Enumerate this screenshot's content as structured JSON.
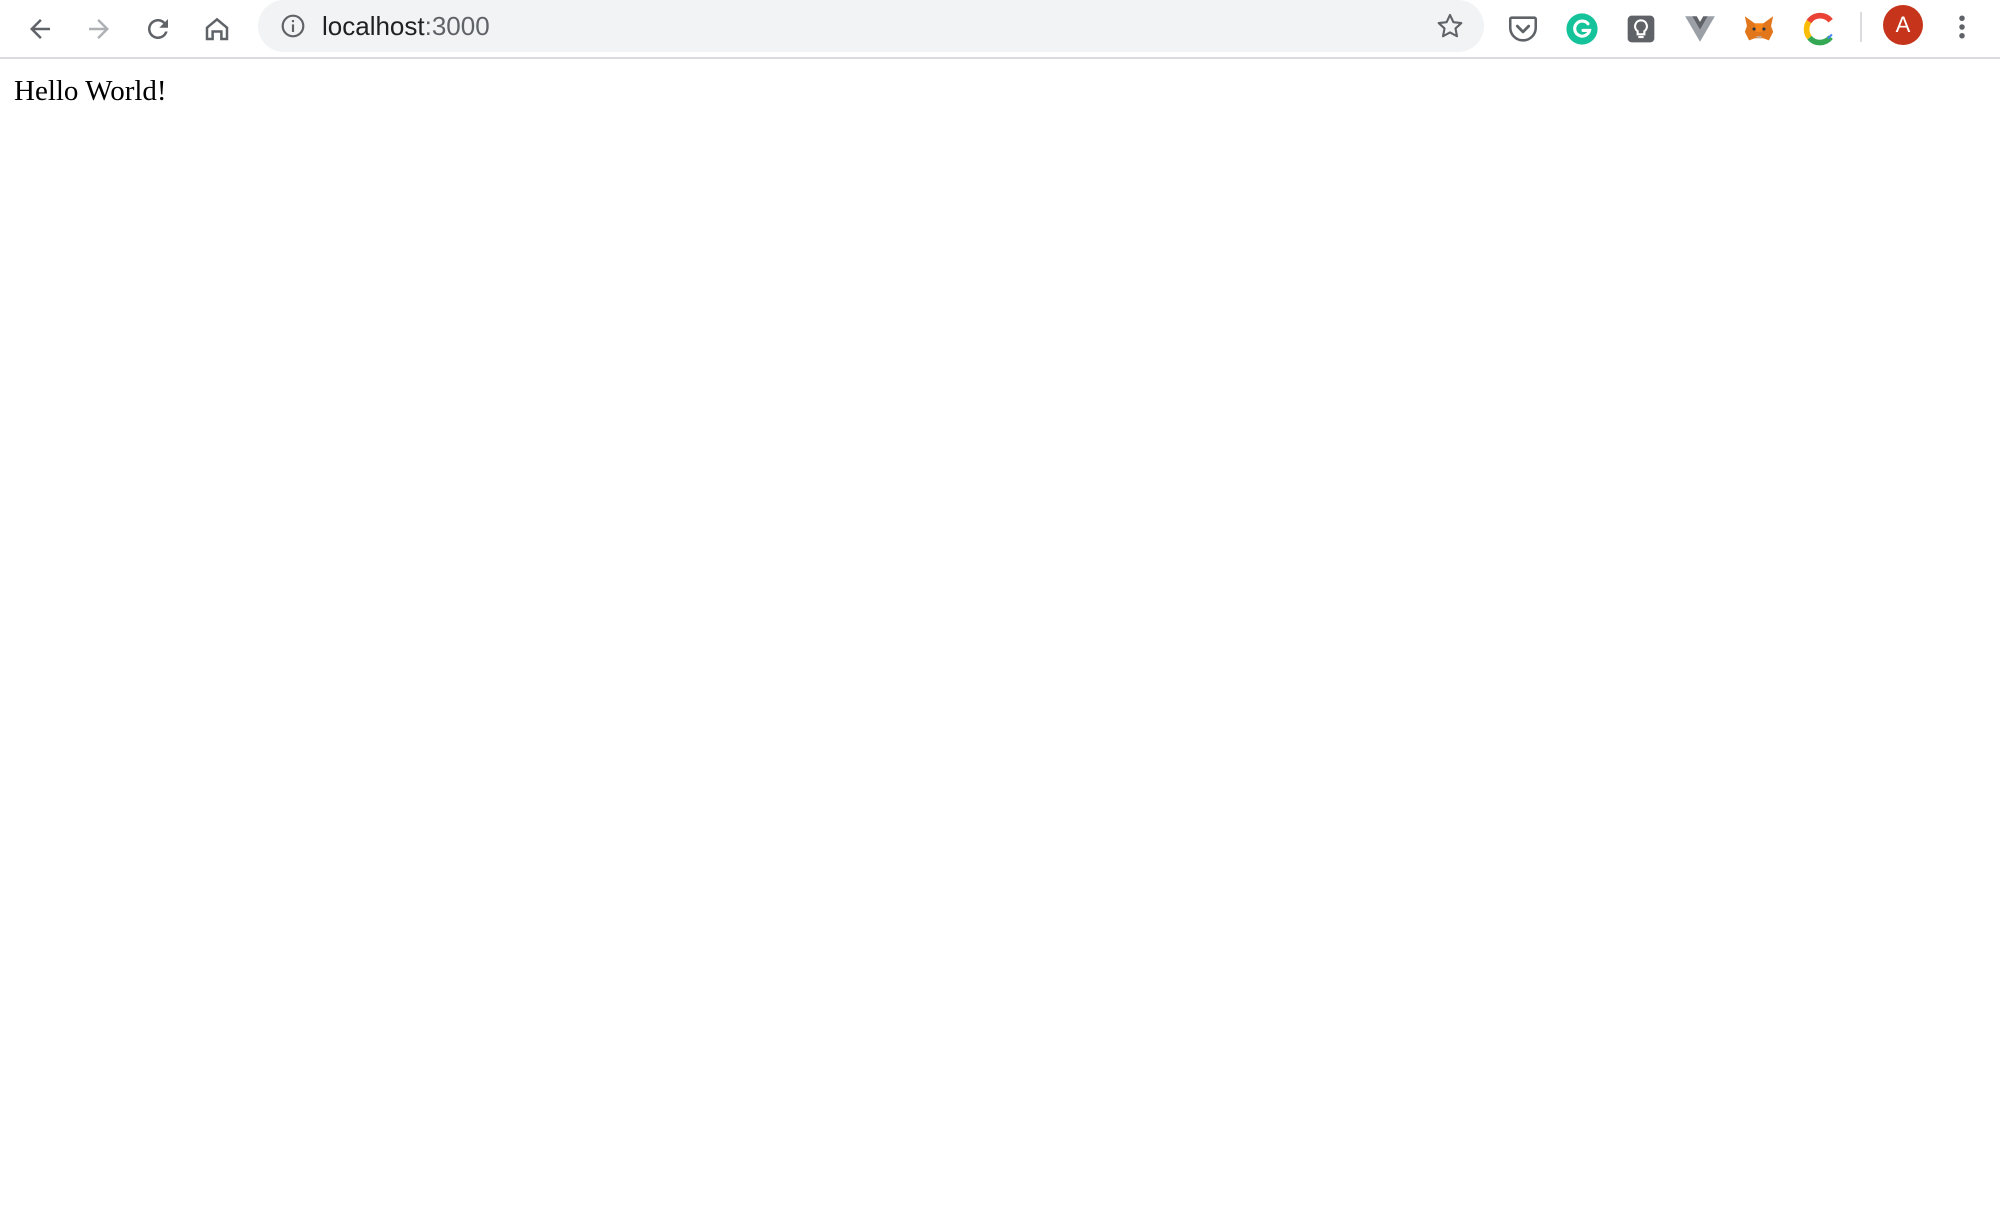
{
  "browser": {
    "address_bar": {
      "host": "localhost",
      "port": ":3000"
    },
    "icons": {
      "back": "arrow-left-icon",
      "forward": "arrow-right-icon",
      "reload": "reload-icon",
      "home": "home-icon",
      "site_info": "info-circle-icon",
      "bookmark": "star-icon",
      "menu": "three-dots-vertical-icon"
    },
    "extensions": [
      "pocket-icon",
      "grammarly-icon",
      "lightbulb-icon",
      "vue-devtools-icon",
      "metamask-icon",
      "chrome-c-icon"
    ],
    "profile": {
      "initial": "A",
      "color": "#c5341b"
    },
    "colors": {
      "toolbar_icon": "#5f6368",
      "forward_disabled": "#aeb1b5",
      "grammarly": "#15c39a",
      "metamask": "#e2761b"
    }
  },
  "page": {
    "body_text": "Hello World!"
  }
}
